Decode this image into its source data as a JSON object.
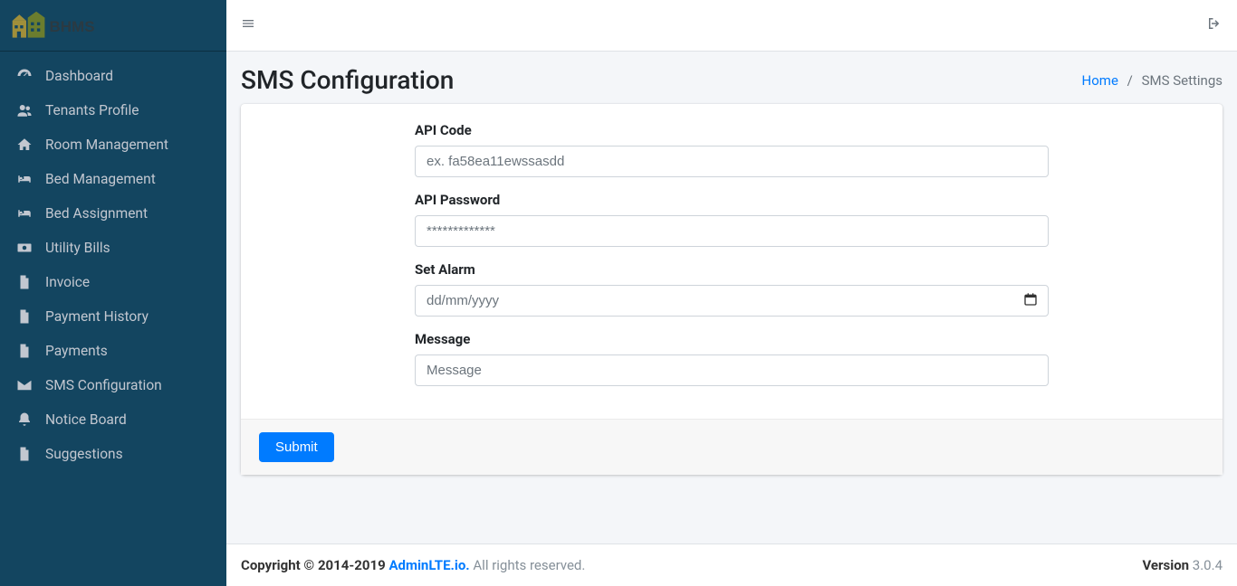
{
  "brand": {
    "text": "BHMS"
  },
  "sidebar": {
    "items": [
      {
        "label": "Dashboard",
        "icon": "dashboard"
      },
      {
        "label": "Tenants Profile",
        "icon": "users"
      },
      {
        "label": "Room Management",
        "icon": "home"
      },
      {
        "label": "Bed Management",
        "icon": "bed"
      },
      {
        "label": "Bed Assignment",
        "icon": "bed"
      },
      {
        "label": "Utility Bills",
        "icon": "money"
      },
      {
        "label": "Invoice",
        "icon": "file"
      },
      {
        "label": "Payment History",
        "icon": "file"
      },
      {
        "label": "Payments",
        "icon": "file"
      },
      {
        "label": "SMS Configuration",
        "icon": "envelope"
      },
      {
        "label": "Notice Board",
        "icon": "bell"
      },
      {
        "label": "Suggestions",
        "icon": "file"
      }
    ]
  },
  "header": {
    "title": "SMS Configuration",
    "breadcrumb_home": "Home",
    "breadcrumb_current": "SMS Settings"
  },
  "form": {
    "api_code": {
      "label": "API Code",
      "placeholder": "ex. fa58ea11ewssasdd",
      "value": ""
    },
    "api_password": {
      "label": "API Password",
      "placeholder": "*************",
      "value": ""
    },
    "set_alarm": {
      "label": "Set Alarm",
      "placeholder": "dd/mm/yyyy",
      "value": ""
    },
    "message": {
      "label": "Message",
      "placeholder": "Message",
      "value": ""
    },
    "submit_label": "Submit"
  },
  "footer": {
    "copyright_prefix": "Copyright © 2014-2019 ",
    "brand_link": "AdminLTE.io.",
    "rights": " All rights reserved.",
    "version_label": "Version",
    "version": " 3.0.4"
  }
}
